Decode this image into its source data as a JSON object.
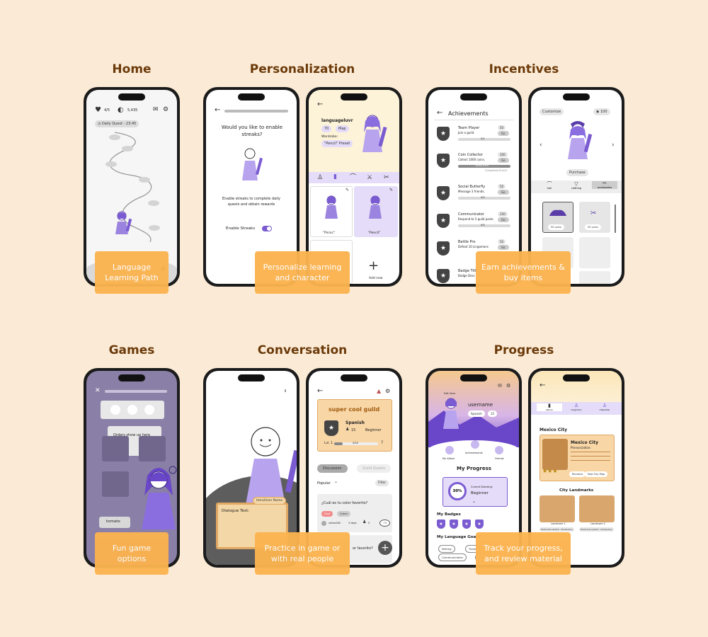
{
  "sections": {
    "home": "Home",
    "personalization": "Personalization",
    "incentives": "Incentives",
    "games": "Games",
    "conversation": "Conversation",
    "progress": "Progress"
  },
  "captions": {
    "home": "Language Learning Path",
    "personalization": "Personalize learning and character",
    "incentives": "Earn achievements & buy items",
    "games": "Fun game options",
    "conversation": "Practice in game or with real people",
    "progress": "Track your progress, and review material"
  },
  "home_screen": {
    "hearts": "4/5",
    "coins": "5,435",
    "daily_quest": "Daily Quest - 23:45"
  },
  "streak_screen": {
    "question": "Would you like to enable streaks?",
    "body": "Enable streaks to complete daily quests and obtain rewards",
    "toggle_label": "Enable Streaks"
  },
  "profile_screen": {
    "username": "languageluvr",
    "stat1": "70",
    "stat2": "Map",
    "wardrobe_label": "Wardrobe:",
    "wardrobe_value": "\"Pencil\" Preset",
    "item1": "\"Picnic\"",
    "item2": "\"Pencil\"",
    "add_new": "Add new"
  },
  "achievements_screen": {
    "title": "Achievements",
    "items": [
      {
        "name": "Team Player",
        "desc": "Join a guild.",
        "reward": "50",
        "progress": "0/1",
        "action": "Go"
      },
      {
        "name": "Coin Collector",
        "desc": "Collect 1000 coins.",
        "reward": "100",
        "progress": "1000/1000",
        "action": "Go",
        "note": "Completed 8/4/24"
      },
      {
        "name": "Social Butterfly",
        "desc": "Message 3 friends.",
        "reward": "50",
        "progress": "0/3",
        "action": "Go"
      },
      {
        "name": "Communicator",
        "desc": "Respond to 5 guild posts.",
        "reward": "150",
        "progress": "0/5",
        "action": "Go"
      },
      {
        "name": "Battle Pro",
        "desc": "Defeat 10 Lingomons",
        "reward": "50",
        "progress": "",
        "action": "Go"
      },
      {
        "name": "Badge Title",
        "desc": "Badge Desc",
        "reward": "",
        "progress": "",
        "action": ""
      }
    ]
  },
  "shop_screen": {
    "customize": "Customize",
    "coins": "100",
    "purchase": "Purchase",
    "tabs": [
      "hair",
      "clothing",
      "accessories"
    ],
    "price1": "50 coins",
    "price2": "50 coins"
  },
  "game_screen": {
    "prompt": "Orders show up here",
    "word": "tomato"
  },
  "dialogue_screen": {
    "name_tag": "Hero/User Name",
    "dialogue": "Dialogue Text:"
  },
  "guild_screen": {
    "name": "super cool guild",
    "language": "Spanish",
    "members": "15",
    "level": "Beginner",
    "lvl": "Lvl. 1",
    "xp": "5/30",
    "tab_discussion": "Discussion",
    "tab_quests": "Guild Quests",
    "sort": "Popular",
    "filter": "Filter",
    "post_title": "¿Cuál es tu color favorito?",
    "tag1": "Hard",
    "tag2": "Colors",
    "author": "carlos182",
    "age": "3 days",
    "replies": "5",
    "votes": "+3",
    "post2_tail": "or favorito?"
  },
  "progress_screen": {
    "edit": "Edit Hero",
    "username": "username",
    "lang": "Spanish",
    "count": "15",
    "my_album": "My Album",
    "achievements": "Achievements",
    "friends": "Friends",
    "my_progress": "My Progress",
    "percent": "30%",
    "standing_label": "Current Standing:",
    "standing": "Beginner",
    "badges": "My Badges",
    "goals": "My Language Goals",
    "goal_chips": [
      "Writing",
      "Travel",
      "Communication",
      "Culture"
    ]
  },
  "album_screen": {
    "tabs": [
      "Album",
      "Lingomon",
      "Character"
    ],
    "city": "Mexico City",
    "card_title": "Mexico City",
    "card_sub": "Pronunciation:",
    "btn1": "Revisitar",
    "btn2": "New City Map",
    "landmarks": "City Landmarks",
    "landmark1": "Landmark 1",
    "landmark2": "Landmark 2",
    "chips": [
      "Historical Landmarks",
      "Vocabulary",
      "Historical Landmarks",
      "Vocabulary"
    ]
  },
  "colors": {
    "background": "#fbebd6",
    "title": "#6b3a0a",
    "caption": "#fbb34f",
    "accent": "#7b5bd1"
  }
}
